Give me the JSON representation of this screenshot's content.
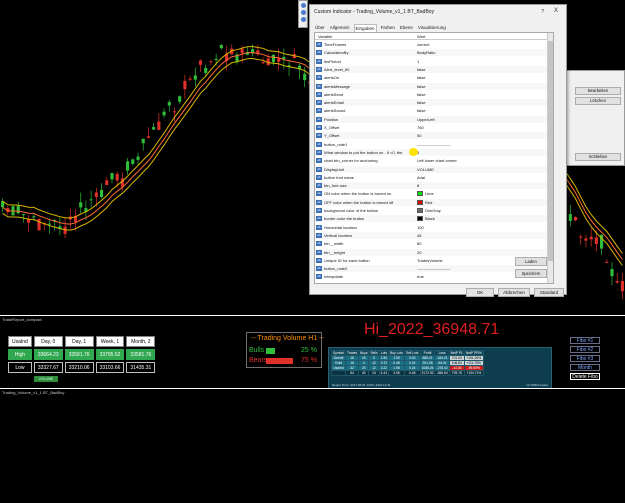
{
  "chart": {
    "subwindow1_label": "TradeReport_compact",
    "subwindow2_label": "Trading_Volume_v1_1 BT_BadBoy",
    "colors": {
      "bull": "#2fbf3a",
      "bear": "#e0302a",
      "ma": "#d8b800"
    }
  },
  "price_table": {
    "headers": [
      "UsaInd",
      "Day, 0",
      "Day, 1",
      "Week, 1",
      "Month, 2"
    ],
    "high": [
      "High",
      "33664.23",
      "33581.76",
      "33795.52",
      "33581.76"
    ],
    "low": [
      "Low",
      "33327.67",
      "33210.06",
      "33103.66",
      "31435.31"
    ],
    "volume_button": "VOLUME"
  },
  "trading_volume": {
    "title": "-- Trading Volume H1 --",
    "bulls_label": "Bulls",
    "bulls_pct": "25 %",
    "bulls_fraction": 0.25,
    "bears_label": "Bears",
    "bears_pct": "75 %",
    "bears_fraction": 0.75
  },
  "hi_label": "Hi_2022_36948.71",
  "report": {
    "headers": [
      "Symbol",
      "Trades",
      "Buys",
      "Sells",
      "Lots",
      "Buy Lots",
      "Sell Lots",
      "Profit",
      "Loss",
      "NetP PL",
      "NetP PR%"
    ],
    "rows": [
      [
        "Detroit",
        "16",
        "16",
        "0",
        "1.50",
        "1.50",
        "0.00",
        "885.21",
        "-184.21",
        "701.00",
        "+151.26%"
      ],
      [
        "Gold",
        "16",
        "4",
        "12",
        "0.72",
        "0.48",
        "0.24",
        "201.05",
        "-94.21",
        "106.84",
        "+111.75%"
      ],
      [
        "UsaInd",
        "32",
        "20",
        "12",
        "2.22",
        "1.98",
        "0.24",
        "1086.26",
        "-278.42",
        "-14.06",
        "-99.89%"
      ],
      [
        "",
        "64",
        "40",
        "24",
        "4.44",
        "3.96",
        "0.48",
        "2172.52",
        "-556.84",
        "793.78",
        "+134.71%"
      ]
    ],
    "footer_left": "Report From: 2017.05.01 13:00, 2021.12.31",
    "footer_right": "14 OPEN trades"
  },
  "fibo_buttons": [
    "Fibo #1",
    "Fibo #2",
    "Fibo #3",
    "Month",
    "Delete Fibo"
  ],
  "dialog": {
    "title": "Custom Indicator - Trading_Volume_v1_1 BT_BadBoy",
    "help": "?",
    "close": "X",
    "tabs": [
      "Über",
      "Allgemein",
      "Eingaben",
      "Farben",
      "Ebene",
      "Visualisierung"
    ],
    "grid_header": {
      "variable": "Variable",
      "value": "Wert"
    },
    "params": [
      {
        "name": "TimeFrames",
        "value": "current"
      },
      {
        "name": "CalculationBy",
        "value": "BodyRatio"
      },
      {
        "name": "lbsPeriod",
        "value": "1"
      },
      {
        "name": "Alert_level_60",
        "value": "false"
      },
      {
        "name": "alertsOn",
        "value": "false"
      },
      {
        "name": "alertsMessage",
        "value": "false"
      },
      {
        "name": "alertsSend",
        "value": "false"
      },
      {
        "name": "alertsEmail",
        "value": "false"
      },
      {
        "name": "alertsSound",
        "value": "false"
      },
      {
        "name": "Position",
        "value": "UpperLeft"
      },
      {
        "name": "X_Offset",
        "value": "760"
      },
      {
        "name": "Y_Offset",
        "value": "50"
      },
      {
        "name": "button_note1",
        "value": "-------------------------"
      },
      {
        "name": "What window to put the button on . If <0, the",
        "value": "1"
      },
      {
        "name": "chart btn_corner for anchoring",
        "value": "Left lower chart corner"
      },
      {
        "name": "DisplayUnit",
        "value": "VOLUME"
      },
      {
        "name": "button font name",
        "value": "Arial"
      },
      {
        "name": "btn_font size",
        "value": "8"
      },
      {
        "name": "ON color when the button is turned on",
        "value": "Lime",
        "swatch": "#00e000"
      },
      {
        "name": "OFF color when the button is turned off",
        "value": "Red",
        "swatch": "#e00000"
      },
      {
        "name": "background color of the button",
        "value": "DimGray",
        "swatch": "#696969"
      },
      {
        "name": "border color the button",
        "value": "Black",
        "swatch": "#000000"
      },
      {
        "name": "Horizontal location",
        "value": "100"
      },
      {
        "name": "Vertical location",
        "value": "45"
      },
      {
        "name": "btn__width",
        "value": "80"
      },
      {
        "name": "btn__height",
        "value": "20"
      },
      {
        "name": "Unique ID for each button",
        "value": "TradesVolume"
      },
      {
        "name": "button_note2",
        "value": "-------------------------"
      },
      {
        "name": "Interpolate",
        "value": "true"
      }
    ],
    "side_buttons": {
      "load": "Laden",
      "save": "Speichern"
    },
    "buttons": {
      "ok": "OK",
      "cancel": "Abbrechen",
      "default": "Standard"
    }
  },
  "peek_dialog": {
    "edit": "Bearbeiten",
    "delete": "Löschen",
    "close": "Schließen"
  }
}
